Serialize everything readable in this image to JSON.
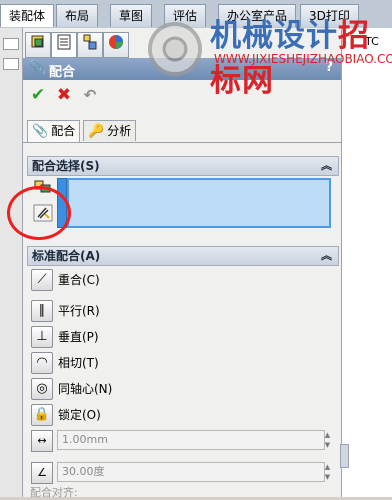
{
  "ribbon": {
    "tabs": [
      {
        "label": "装配体"
      },
      {
        "label": "布局"
      },
      {
        "label": "草图"
      },
      {
        "label": "评估"
      },
      {
        "label": "办公室产品"
      },
      {
        "label": "3D打印"
      }
    ],
    "right_edge_text": "TC"
  },
  "watermark": {
    "text_blue": "机械设计",
    "text_red": "招标网",
    "url": "WWW.JIXIESHEJIZHAOBIAO.COM"
  },
  "manager_tabs": [
    {
      "icon": "feature-manager-icon"
    },
    {
      "icon": "property-manager-icon"
    },
    {
      "icon": "configuration-manager-icon"
    },
    {
      "icon": "display-manager-icon"
    }
  ],
  "property_manager": {
    "title": "配合",
    "help": "?",
    "ok_glyph": "✔",
    "cancel_glyph": "✖",
    "undo_glyph": "↶",
    "subtabs": [
      {
        "label": "配合"
      },
      {
        "label": "分析"
      }
    ]
  },
  "mate_selection": {
    "header": "配合选择(S)",
    "chevron": "︽"
  },
  "standard_mates": {
    "header": "标准配合(A)",
    "chevron": "︽",
    "items": [
      {
        "label": "重合(C)",
        "glyph": "⟋"
      },
      {
        "label": "平行(R)",
        "glyph": "∥"
      },
      {
        "label": "垂直(P)",
        "glyph": "⊥"
      },
      {
        "label": "相切(T)",
        "glyph": "◠"
      },
      {
        "label": "同轴心(N)",
        "glyph": "◎"
      },
      {
        "label": "锁定(O)",
        "glyph": "🔒"
      }
    ],
    "distance": {
      "value": "1.00mm",
      "glyph": "↔"
    },
    "angle": {
      "value": "30.00度",
      "glyph": "∠"
    },
    "alignment_label": "配合对齐:"
  },
  "colors": {
    "selection_box": "#bcdcf7",
    "selection_bar": "#3b8fe0",
    "annotation_circle": "#ee1f1f",
    "title_bar": "#7b95bd"
  }
}
